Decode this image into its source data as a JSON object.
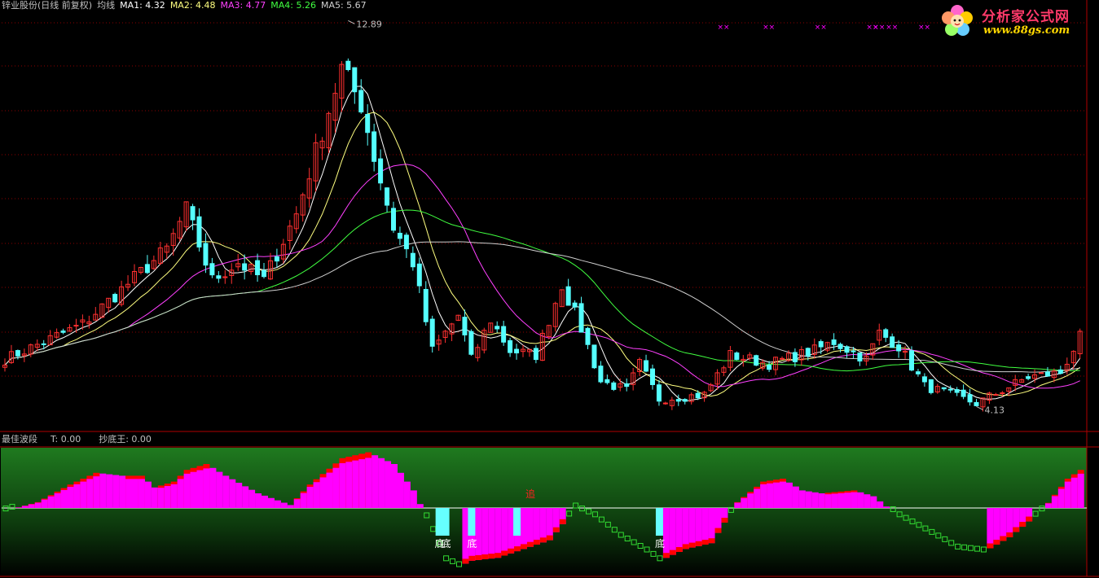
{
  "header": {
    "stock_name": "锌业股份(日线 前复权)",
    "indicator_name": "均线",
    "ma_labels": [
      {
        "text": "MA1: 4.32",
        "color": "#ffffff"
      },
      {
        "text": "MA2: 4.48",
        "color": "#ffff80"
      },
      {
        "text": "MA3: 4.77",
        "color": "#ff40ff"
      },
      {
        "text": "MA4: 5.26",
        "color": "#40ff40"
      },
      {
        "text": "MA5: 5.67",
        "color": "#d0d0d0"
      }
    ]
  },
  "sub_header": {
    "indicator_name": "最佳波段",
    "t_label": "T: 0.00",
    "bottom_king_label": "抄底王: 0.00"
  },
  "logo": {
    "title": "分析家公式网",
    "url": "www.88gs.com",
    "icon_name": "flower-mascot-icon"
  },
  "colors": {
    "up": "#ff3030",
    "down": "#55ffff",
    "grid": "#8b0000",
    "panel_green": "#1f7a1f",
    "magenta": "#ff00ff",
    "red": "#ff0000",
    "yellow": "#ffff00",
    "cyan": "#66ffff"
  },
  "chart_data": [
    {
      "type": "candlestick",
      "title": "锌业股份(日线 前复权) 均线",
      "ylim": [
        3.6,
        13.1
      ],
      "annotations": [
        {
          "text": "12.89",
          "kind": "high",
          "x": 53,
          "y": 12.89
        },
        {
          "text": "4.13",
          "kind": "low",
          "x": 150,
          "y": 4.13
        }
      ],
      "markers": {
        "text": "××",
        "x": [
          110,
          117,
          125,
          133,
          134,
          136,
          141
        ]
      },
      "close_anchors": [
        [
          0,
          5.2
        ],
        [
          12,
          6.0
        ],
        [
          25,
          7.7
        ],
        [
          28,
          8.6
        ],
        [
          32,
          7.0
        ],
        [
          36,
          7.4
        ],
        [
          40,
          7.0
        ],
        [
          45,
          8.5
        ],
        [
          52,
          11.8
        ],
        [
          55,
          11.0
        ],
        [
          57,
          9.8
        ],
        [
          60,
          8.2
        ],
        [
          63,
          7.4
        ],
        [
          66,
          5.4
        ],
        [
          70,
          6.2
        ],
        [
          72,
          5.2
        ],
        [
          75,
          6.1
        ],
        [
          78,
          5.4
        ],
        [
          82,
          5.3
        ],
        [
          86,
          6.9
        ],
        [
          89,
          5.9
        ],
        [
          92,
          4.7
        ],
        [
          96,
          4.5
        ],
        [
          98,
          5.1
        ],
        [
          101,
          4.3
        ],
        [
          108,
          4.4
        ],
        [
          112,
          5.3
        ],
        [
          118,
          5.1
        ],
        [
          125,
          5.4
        ],
        [
          128,
          5.6
        ],
        [
          133,
          5.2
        ],
        [
          135,
          5.8
        ],
        [
          138,
          5.5
        ],
        [
          142,
          4.6
        ],
        [
          150,
          4.2
        ],
        [
          154,
          4.5
        ],
        [
          158,
          4.8
        ],
        [
          163,
          4.9
        ],
        [
          166,
          5.7
        ]
      ],
      "series": [
        {
          "name": "MA1",
          "period": 5
        },
        {
          "name": "MA2",
          "period": 10
        },
        {
          "name": "MA3",
          "period": 20
        },
        {
          "name": "MA4",
          "period": 40
        },
        {
          "name": "MA5",
          "period": 60
        }
      ]
    },
    {
      "type": "bar",
      "title": "最佳波段",
      "ylim": [
        -1.0,
        1.0
      ],
      "annotations": [
        {
          "text": "底",
          "x": 67
        },
        {
          "text": "底",
          "x": 68
        },
        {
          "text": "底",
          "x": 72
        },
        {
          "text": "底",
          "x": 101
        },
        {
          "text": "追",
          "x": 81
        }
      ],
      "bottom_signal_x": [
        67,
        68,
        72,
        79,
        101
      ],
      "wave_anchors": [
        [
          0,
          -0.05
        ],
        [
          5,
          0.1
        ],
        [
          10,
          0.4
        ],
        [
          14,
          0.6
        ],
        [
          18,
          0.55
        ],
        [
          21,
          0.55
        ],
        [
          23,
          0.35
        ],
        [
          26,
          0.45
        ],
        [
          28,
          0.65
        ],
        [
          31,
          0.75
        ],
        [
          34,
          0.55
        ],
        [
          39,
          0.25
        ],
        [
          44,
          0.05
        ],
        [
          47,
          0.4
        ],
        [
          52,
          0.85
        ],
        [
          56,
          0.95
        ],
        [
          60,
          0.75
        ],
        [
          63,
          0.3
        ],
        [
          66,
          -0.4
        ],
        [
          68,
          -0.9
        ],
        [
          70,
          -1.0
        ],
        [
          72,
          -0.9
        ],
        [
          76,
          -0.85
        ],
        [
          80,
          -0.7
        ],
        [
          84,
          -0.55
        ],
        [
          88,
          0.0
        ],
        [
          91,
          -0.15
        ],
        [
          95,
          -0.5
        ],
        [
          99,
          -0.75
        ],
        [
          101,
          -0.9
        ],
        [
          105,
          -0.7
        ],
        [
          109,
          -0.6
        ],
        [
          113,
          0.1
        ],
        [
          117,
          0.45
        ],
        [
          120,
          0.5
        ],
        [
          123,
          0.3
        ],
        [
          126,
          0.25
        ],
        [
          131,
          0.3
        ],
        [
          134,
          0.2
        ],
        [
          138,
          -0.15
        ],
        [
          143,
          -0.45
        ],
        [
          147,
          -0.7
        ],
        [
          151,
          -0.75
        ],
        [
          155,
          -0.5
        ],
        [
          160,
          -0.05
        ],
        [
          164,
          0.5
        ],
        [
          166,
          0.65
        ]
      ]
    }
  ]
}
